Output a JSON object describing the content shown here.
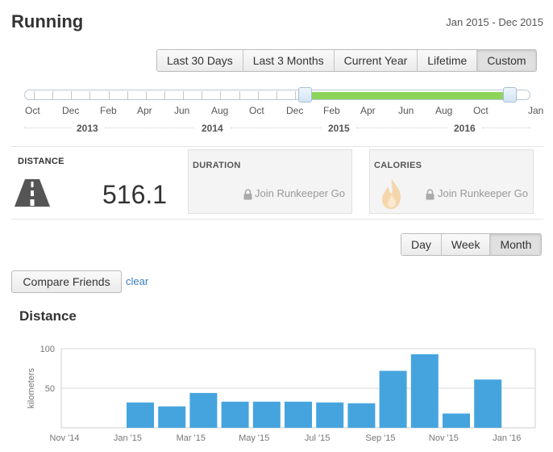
{
  "header": {
    "title": "Running",
    "date_range": "Jan 2015 - Dec 2015"
  },
  "range_buttons": [
    {
      "label": "Last 30 Days",
      "active": false
    },
    {
      "label": "Last 3 Months",
      "active": false
    },
    {
      "label": "Current Year",
      "active": false
    },
    {
      "label": "Lifetime",
      "active": false
    },
    {
      "label": "Custom",
      "active": true
    }
  ],
  "timeline": {
    "months": [
      "Oct",
      "Dec",
      "Feb",
      "Apr",
      "Jun",
      "Aug",
      "Oct",
      "Dec",
      "Feb",
      "Apr",
      "Jun",
      "Aug",
      "Oct",
      "Jan"
    ],
    "years": [
      "2013",
      "2014",
      "2015",
      "2016"
    ],
    "selected_from": "Jan 2015",
    "selected_to": "Dec 2015"
  },
  "stats": {
    "distance": {
      "title": "DISTANCE",
      "value": "516.1"
    },
    "duration": {
      "title": "DURATION",
      "locked_text": "Join Runkeeper Go"
    },
    "calories": {
      "title": "CALORIES",
      "locked_text": "Join Runkeeper Go"
    }
  },
  "period_buttons": [
    {
      "label": "Day",
      "active": false
    },
    {
      "label": "Week",
      "active": false
    },
    {
      "label": "Month",
      "active": true
    }
  ],
  "compare": {
    "button_label": "Compare Friends",
    "clear_label": "clear"
  },
  "chart_heading": "Distance",
  "icons": {
    "distance": "road-icon",
    "lock": "lock-icon",
    "calories": "flame-icon"
  },
  "colors": {
    "bar": "#45a4de",
    "range_fill": "#8cd45a",
    "link": "#3a7fc1"
  },
  "chart_data": {
    "type": "bar",
    "title": "Distance",
    "ylabel": "kilometers",
    "xlabel": "",
    "ylim": [
      0,
      100
    ],
    "yticks": [
      50,
      100
    ],
    "xtick_labels": [
      "Nov '14",
      "Jan '15",
      "Mar '15",
      "May '15",
      "Jul '15",
      "Sep '15",
      "Nov '15",
      "Jan '16"
    ],
    "categories": [
      "Jan 2015",
      "Feb 2015",
      "Mar 2015",
      "Apr 2015",
      "May 2015",
      "Jun 2015",
      "Jul 2015",
      "Aug 2015",
      "Sep 2015",
      "Oct 2015",
      "Nov 2015",
      "Dec 2015"
    ],
    "values": [
      32,
      27,
      44,
      33,
      33,
      33,
      32,
      31,
      72,
      93,
      18,
      61
    ],
    "grid": true
  }
}
